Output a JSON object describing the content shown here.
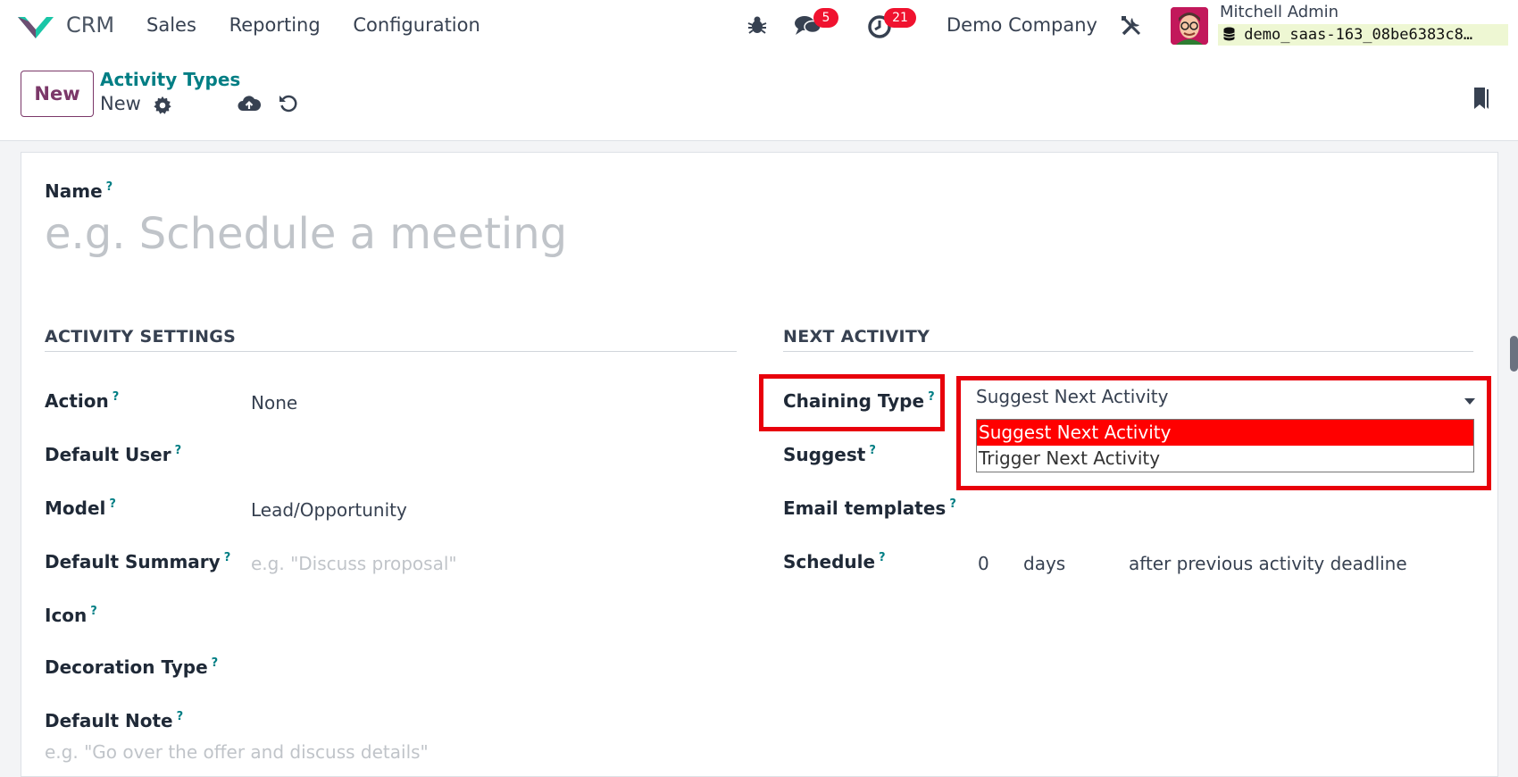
{
  "navbar": {
    "app_name": "CRM",
    "menu": [
      "Sales",
      "Reporting",
      "Configuration"
    ],
    "messages_count": "5",
    "activities_count": "21",
    "company": "Demo Company",
    "user_name": "Mitchell Admin",
    "database": "demo_saas-163_08be6383c8…"
  },
  "control_panel": {
    "new_label": "New",
    "breadcrumb": "Activity Types",
    "record_title": "New"
  },
  "form": {
    "name_label": "Name",
    "name_placeholder": "e.g. Schedule a meeting",
    "activity_settings_title": "ACTIVITY SETTINGS",
    "action_label": "Action",
    "action_value": "None",
    "default_user_label": "Default User",
    "model_label": "Model",
    "model_value": "Lead/Opportunity",
    "default_summary_label": "Default Summary",
    "default_summary_placeholder": "e.g. \"Discuss proposal\"",
    "icon_label": "Icon",
    "decoration_type_label": "Decoration Type",
    "default_note_label": "Default Note",
    "default_note_placeholder": "e.g. \"Go over the offer and discuss details\"",
    "next_activity_title": "NEXT ACTIVITY",
    "chaining_type_label": "Chaining Type",
    "chaining_type_value": "Suggest Next Activity",
    "chaining_type_options": [
      "Suggest Next Activity",
      "Trigger Next Activity"
    ],
    "suggest_label": "Suggest",
    "email_templates_label": "Email templates",
    "schedule_label": "Schedule",
    "schedule_value": "0",
    "schedule_unit": "days",
    "schedule_after": "after previous activity deadline",
    "help_mark": "?"
  },
  "colors": {
    "brand": "#7b3869",
    "link": "#017e84",
    "badge": "#f0122f",
    "highlight": "#e8000b",
    "selected_option": "#ff0000"
  }
}
